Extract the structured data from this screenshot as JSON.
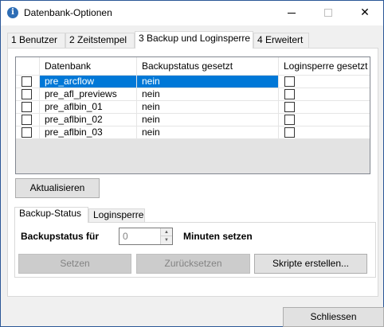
{
  "window": {
    "title": "Datenbank-Optionen",
    "icon": "info-icon",
    "controls": {
      "minimize": "minimize-icon",
      "maximize": "maximize-icon",
      "close": "✕"
    }
  },
  "tabs": [
    {
      "label": "1 Benutzer"
    },
    {
      "label": "2 Zeitstempel"
    },
    {
      "label": "3 Backup und Loginsperre"
    },
    {
      "label": "4 Erweitert"
    }
  ],
  "grid": {
    "columns": [
      "Datenbank",
      "Backupstatus gesetzt",
      "Loginsperre gesetzt"
    ],
    "rows": [
      {
        "name": "pre_arcflow",
        "backup": "nein",
        "selected": true
      },
      {
        "name": "pre_afl_previews",
        "backup": "nein",
        "selected": false
      },
      {
        "name": "pre_aflbin_01",
        "backup": "nein",
        "selected": false
      },
      {
        "name": "pre_aflbin_02",
        "backup": "nein",
        "selected": false
      },
      {
        "name": "pre_aflbin_03",
        "backup": "nein",
        "selected": false
      }
    ]
  },
  "buttons": {
    "refresh": "Aktualisieren",
    "set": "Setzen",
    "reset": "Zurücksetzen",
    "create_scripts": "Skripte erstellen...",
    "close": "Schliessen"
  },
  "subtabs": [
    {
      "label": "Backup-Status"
    },
    {
      "label": "Loginsperre"
    }
  ],
  "backup": {
    "label_before": "Backupstatus für",
    "minutes_value": "0",
    "label_after": "Minuten setzen"
  },
  "colors": {
    "selection": "#0078d7",
    "accent_border": "#2b5797"
  }
}
